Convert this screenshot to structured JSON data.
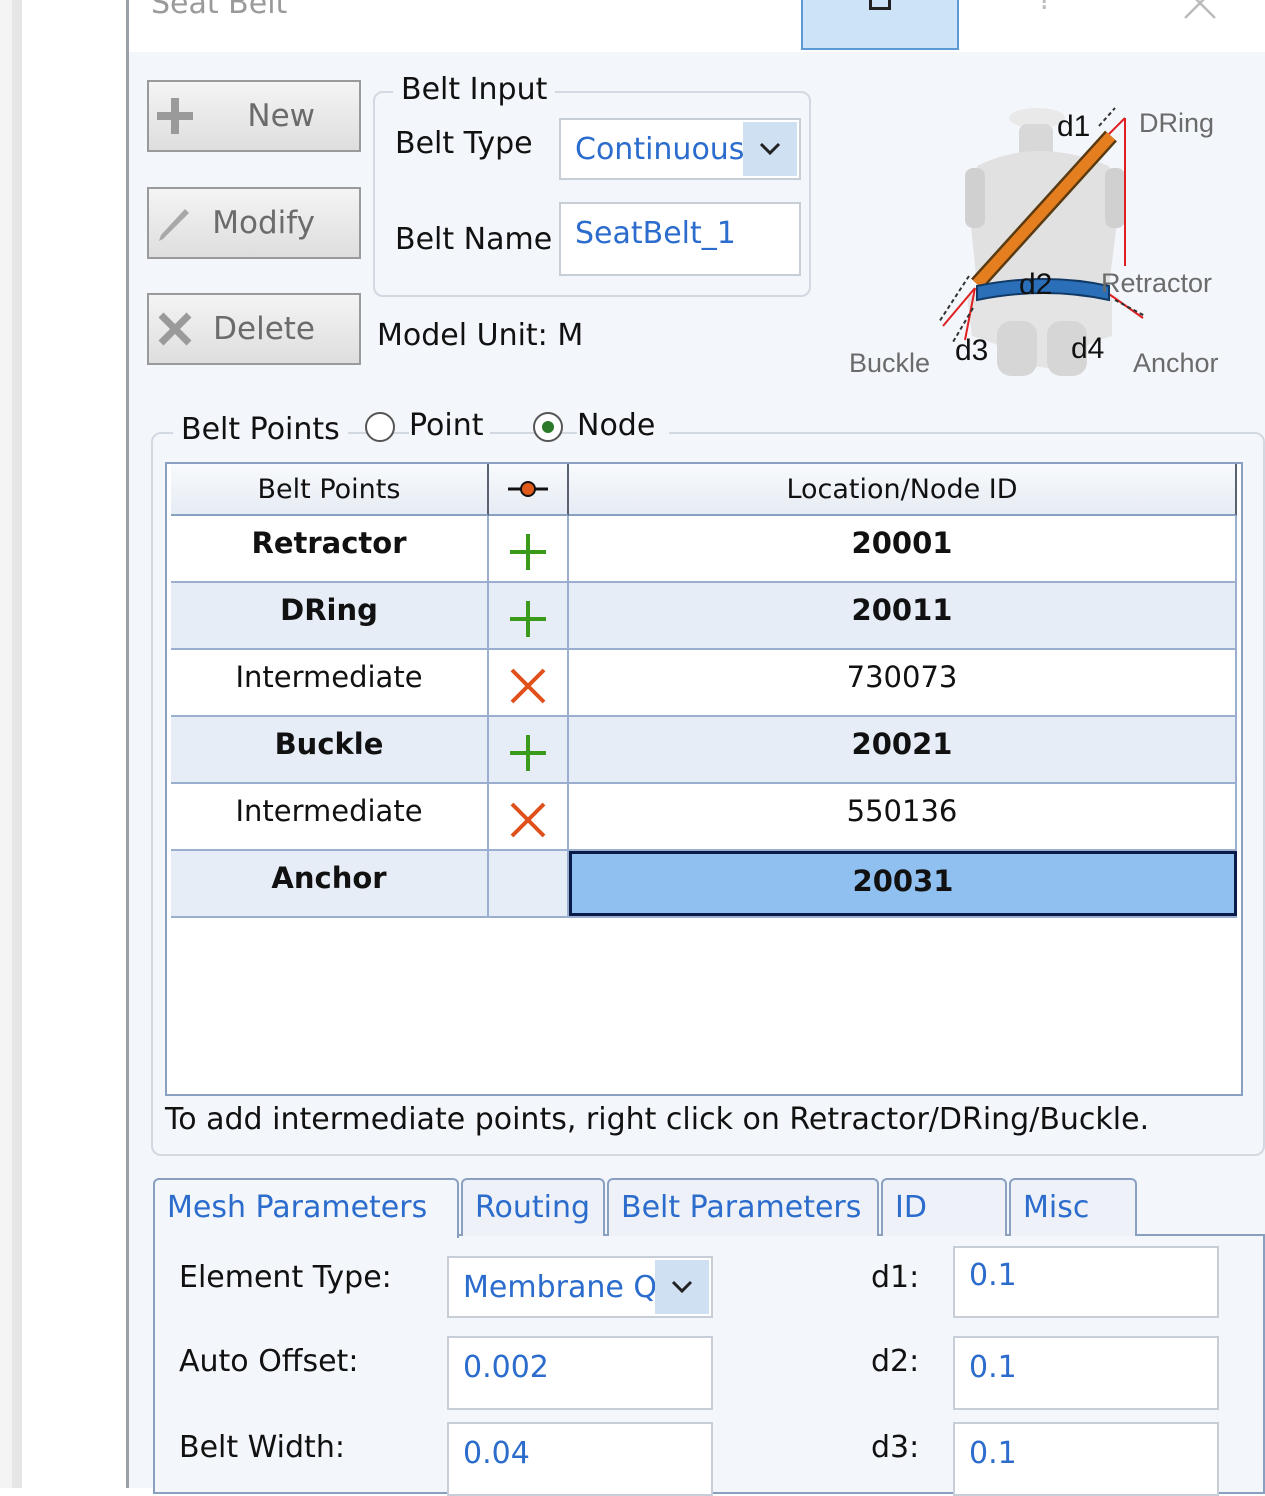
{
  "window": {
    "title": "Seat Belt"
  },
  "actions": {
    "new_label": "New",
    "modify_label": "Modify",
    "delete_label": "Delete"
  },
  "belt_input": {
    "legend": "Belt Input",
    "belt_type_label": "Belt Type",
    "belt_type_value": "Continuous",
    "belt_name_label": "Belt Name",
    "belt_name_value": "SeatBelt_1"
  },
  "model_unit": "Model Unit: M",
  "diagram": {
    "labels": [
      "d1",
      "DRing",
      "d2",
      "Retractor",
      "Buckle",
      "d3",
      "d4",
      "Anchor"
    ],
    "colors": {
      "belt": "#e57e1f",
      "lap": "#2a6fb8",
      "lines": "#e02020"
    }
  },
  "belt_points": {
    "legend": "Belt Points",
    "options": [
      "Point",
      "Node"
    ],
    "selected": "Node",
    "columns": [
      "Belt Points",
      "",
      "Location/Node ID"
    ],
    "rows": [
      {
        "name": "Retractor",
        "icon": "plus-icon",
        "id": "20001",
        "bold": true
      },
      {
        "name": "DRing",
        "icon": "plus-icon",
        "id": "20011",
        "bold": true
      },
      {
        "name": "Intermediate",
        "icon": "x-icon",
        "id": "730073",
        "bold": false
      },
      {
        "name": "Buckle",
        "icon": "plus-icon",
        "id": "20021",
        "bold": true
      },
      {
        "name": "Intermediate",
        "icon": "x-icon",
        "id": "550136",
        "bold": false
      },
      {
        "name": "Anchor",
        "icon": "",
        "id": "20031",
        "bold": true
      }
    ],
    "hint": "To add intermediate points, right click on Retractor/DRing/Buckle."
  },
  "tabs": [
    "Mesh Parameters",
    "Routing",
    "Belt Parameters",
    "ID",
    "Misc"
  ],
  "mesh": {
    "element_type_label": "Element Type:",
    "element_type_value": "Membrane Q",
    "auto_offset_label": "Auto Offset:",
    "auto_offset_value": "0.002",
    "belt_width_label": "Belt Width:",
    "belt_width_value": "0.04",
    "d1_label": "d1:",
    "d1_value": "0.1",
    "d2_label": "d2:",
    "d2_value": "0.1",
    "d3_label": "d3:",
    "d3_value": "0.1"
  }
}
